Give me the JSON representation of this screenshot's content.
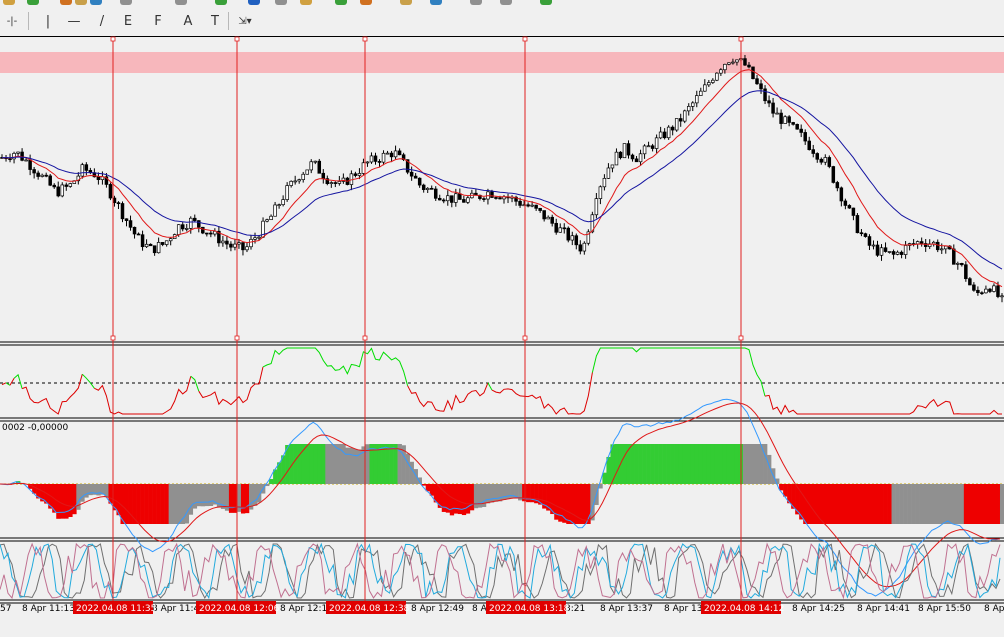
{
  "toolbar": {
    "tools": [
      {
        "id": "crosshair",
        "icon": "crosshair-icon",
        "glyph": "-|-"
      },
      {
        "id": "vline",
        "icon": "vertical-line-icon",
        "glyph": "|"
      },
      {
        "id": "hline",
        "icon": "horizontal-line-icon",
        "glyph": "—"
      },
      {
        "id": "trendline",
        "icon": "trend-line-icon",
        "glyph": "/"
      },
      {
        "id": "equidistant",
        "icon": "equidistant-channel-icon",
        "glyph": "E"
      },
      {
        "id": "fibonacci",
        "icon": "fibonacci-icon",
        "glyph": "F"
      },
      {
        "id": "text",
        "icon": "text-icon",
        "glyph": "A"
      },
      {
        "id": "label",
        "icon": "text-label-icon",
        "glyph": "T"
      },
      {
        "id": "arrows",
        "icon": "arrows-dropdown-icon",
        "glyph": "⇲▾"
      }
    ]
  },
  "colors": {
    "background": "#f0f0f0",
    "zone": "#f7b7bc",
    "vline": "#e02020",
    "ma_fast": "#e01818",
    "ma_slow": "#1414a0",
    "candle_up": "#ffffff",
    "candle_down": "#000000",
    "osc_up": "#00dd00",
    "osc_down": "#dd0000",
    "hist_green": "#33cc33",
    "hist_red": "#ee0000",
    "hist_gray": "#909090",
    "macd_signal": "#e01818",
    "macd_main": "#3399ff",
    "stoch_main": "#c07090",
    "stoch_k": "#22aadd",
    "stoch_d": "#707070",
    "highlight": "#e00000"
  },
  "macd_label": "0002 -0,00000",
  "time_axis": {
    "labels": [
      "57",
      "8 Apr 11:13",
      "8 Apr 11:4",
      "8 Apr 12:1",
      "8 Apr 12:49",
      "8 A",
      "3:21",
      "8 Apr 13:37",
      "8 Apr 13",
      "8 Apr 14:25",
      "8 Apr 14:41",
      "8 Apr 15:50",
      "8 Ap"
    ],
    "highlights": [
      "2022.04.08 11:35",
      "2022.04.08 12:06",
      "2022.04.08 12:38",
      "2022.04.08 13:18",
      "2022.04.08 14:12"
    ]
  },
  "chart_data": {
    "type": "candlestick",
    "series": [
      {
        "name": "price",
        "values": [
          0.62,
          0.64,
          0.6,
          0.55,
          0.5,
          0.52,
          0.58,
          0.56,
          0.5,
          0.42,
          0.34,
          0.3,
          0.32,
          0.38,
          0.4,
          0.37,
          0.34,
          0.31,
          0.3,
          0.36,
          0.42,
          0.5,
          0.56,
          0.6,
          0.55,
          0.52,
          0.56,
          0.6,
          0.62,
          0.64,
          0.58,
          0.52,
          0.5,
          0.48,
          0.47,
          0.48,
          0.5,
          0.49,
          0.47,
          0.45,
          0.42,
          0.38,
          0.34,
          0.3,
          0.5,
          0.6,
          0.65,
          0.62,
          0.66,
          0.7,
          0.74,
          0.8,
          0.86,
          0.93,
          0.97,
          0.94,
          0.86,
          0.78,
          0.74,
          0.7,
          0.65,
          0.6,
          0.5,
          0.4,
          0.32,
          0.29,
          0.28,
          0.31,
          0.33,
          0.32,
          0.29,
          0.24,
          0.14,
          0.18,
          0.12
        ]
      }
    ]
  }
}
